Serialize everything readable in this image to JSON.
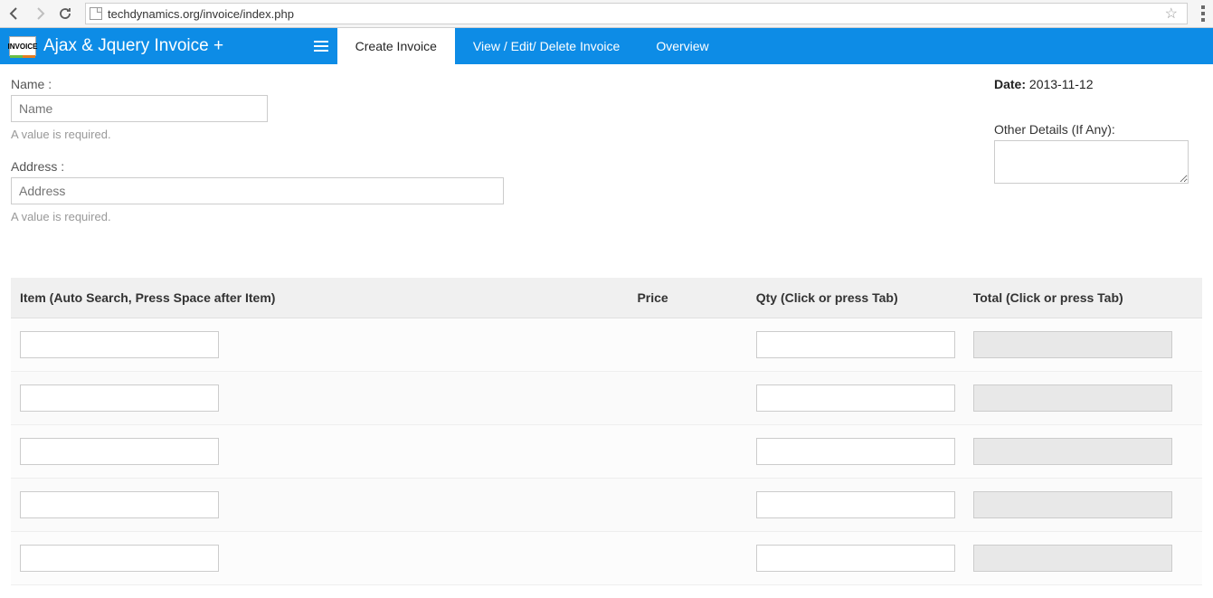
{
  "browser": {
    "url": "techdynamics.org/invoice/index.php"
  },
  "app": {
    "logo_text": "INVOICE",
    "title": "Ajax & Jquery Invoice +",
    "tabs": [
      {
        "label": "Create Invoice",
        "active": true
      },
      {
        "label": "View / Edit/ Delete Invoice",
        "active": false
      },
      {
        "label": "Overview",
        "active": false
      }
    ]
  },
  "form": {
    "name_label": "Name :",
    "name_placeholder": "Name",
    "name_value": "",
    "name_error": "A value is required.",
    "address_label": "Address :",
    "address_placeholder": "Address",
    "address_value": "",
    "address_error": "A value is required.",
    "date_label": "Date:",
    "date_value": "2013-11-12",
    "other_label": "Other Details (If Any):",
    "other_value": ""
  },
  "table": {
    "headers": {
      "item": "Item (Auto Search, Press Space after Item)",
      "price": "Price",
      "qty": "Qty (Click or press Tab)",
      "total": "Total (Click or press Tab)"
    },
    "rows": [
      {
        "item": "",
        "price": "",
        "qty": "",
        "total": ""
      },
      {
        "item": "",
        "price": "",
        "qty": "",
        "total": ""
      },
      {
        "item": "",
        "price": "",
        "qty": "",
        "total": ""
      },
      {
        "item": "",
        "price": "",
        "qty": "",
        "total": ""
      },
      {
        "item": "",
        "price": "",
        "qty": "",
        "total": ""
      }
    ]
  }
}
